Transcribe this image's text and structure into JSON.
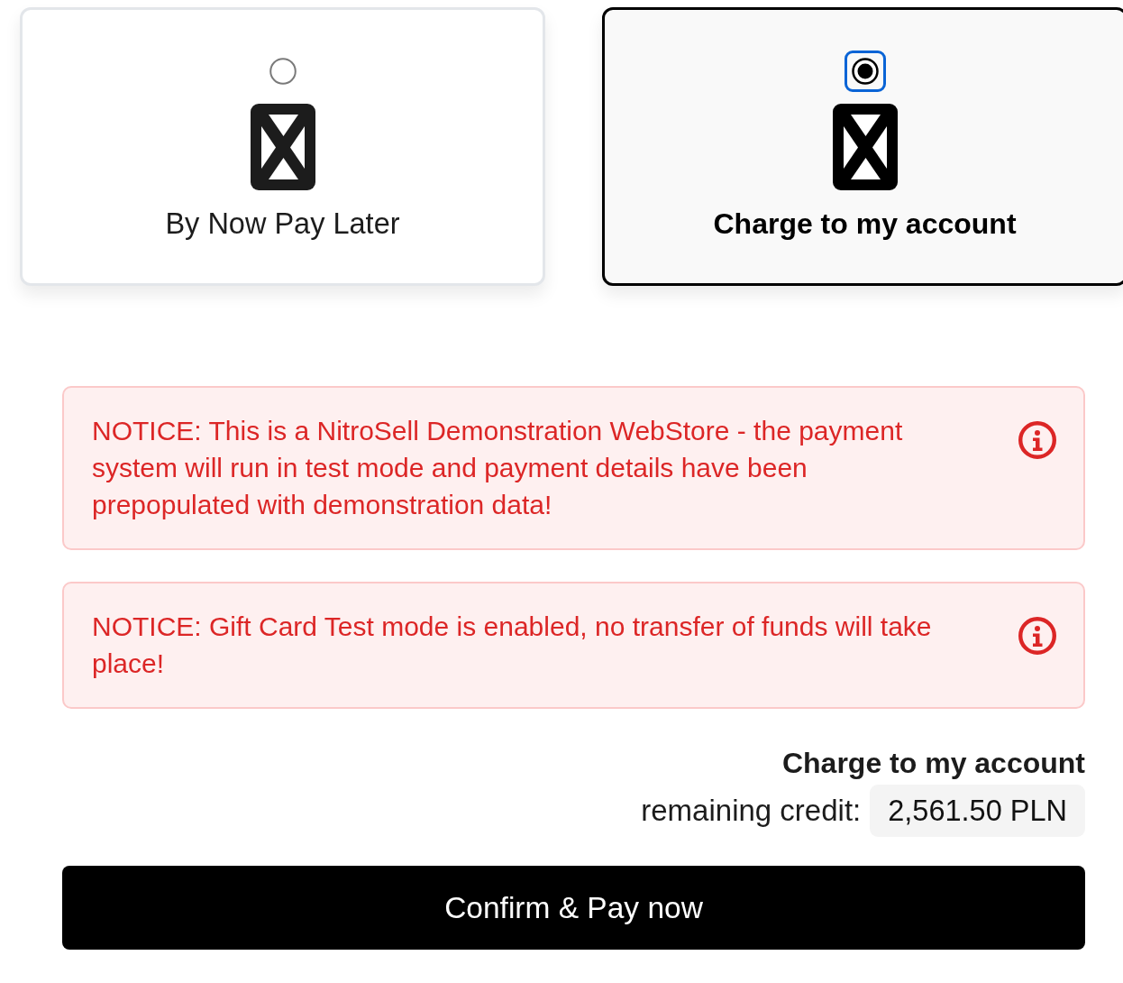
{
  "payment_options": [
    {
      "label": "By Now Pay Later",
      "selected": false,
      "focused": false
    },
    {
      "label": "Charge to my account",
      "selected": true,
      "focused": true
    }
  ],
  "notices": [
    {
      "text": "NOTICE: This is a NitroSell Demonstration WebStore - the payment system will run in test mode and payment details have been prepopulated with demonstration data!"
    },
    {
      "text": "NOTICE: Gift Card Test mode is enabled, no transfer of funds will take place!"
    }
  ],
  "summary": {
    "method": "Charge to my account",
    "credit_label": "remaining credit:",
    "credit_value": "2,561.50 PLN"
  },
  "confirm_button": "Confirm & Pay now"
}
